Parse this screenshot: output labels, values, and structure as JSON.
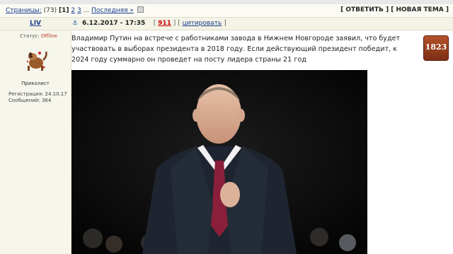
{
  "pagination": {
    "label": "Страницы:",
    "count": "(73)",
    "current": "[1]",
    "pages": [
      "2",
      "3"
    ],
    "ellipsis": "...",
    "last": "Последняя »"
  },
  "actions": {
    "reply": "[ ОТВЕТИТЬ ]",
    "new_topic": "[ НОВАЯ ТЕМА ]"
  },
  "post": {
    "author": "LIV",
    "anchor_icon": "anchor-icon",
    "date": "6.12.2017 - 17:35",
    "number_open": "[",
    "number": "911",
    "number_close": "]",
    "quote_open": "[",
    "quote": "цитировать",
    "quote_close": "]",
    "text": "Владимир Путин на встрече с работниками завода в Нижнем Новгороде заявил, что будет участвовать в выборах президента в 2018 году. Если действующий президент победит, к 2024 году суммарно он проведет на посту лидера страны 21 год"
  },
  "user": {
    "status_label": "Статус:",
    "status_value": "Offline",
    "rank": "Приколист",
    "reg_label": "Регистрация:",
    "reg_date": "24.10.17",
    "posts_label": "Сообщений:",
    "posts_count": "364"
  },
  "badge": {
    "text": "1823"
  },
  "colors": {
    "link": "#1a3d8f",
    "offline": "#c0392b",
    "post_num": "#cc0000",
    "header_bg": "#f3f3e6"
  }
}
